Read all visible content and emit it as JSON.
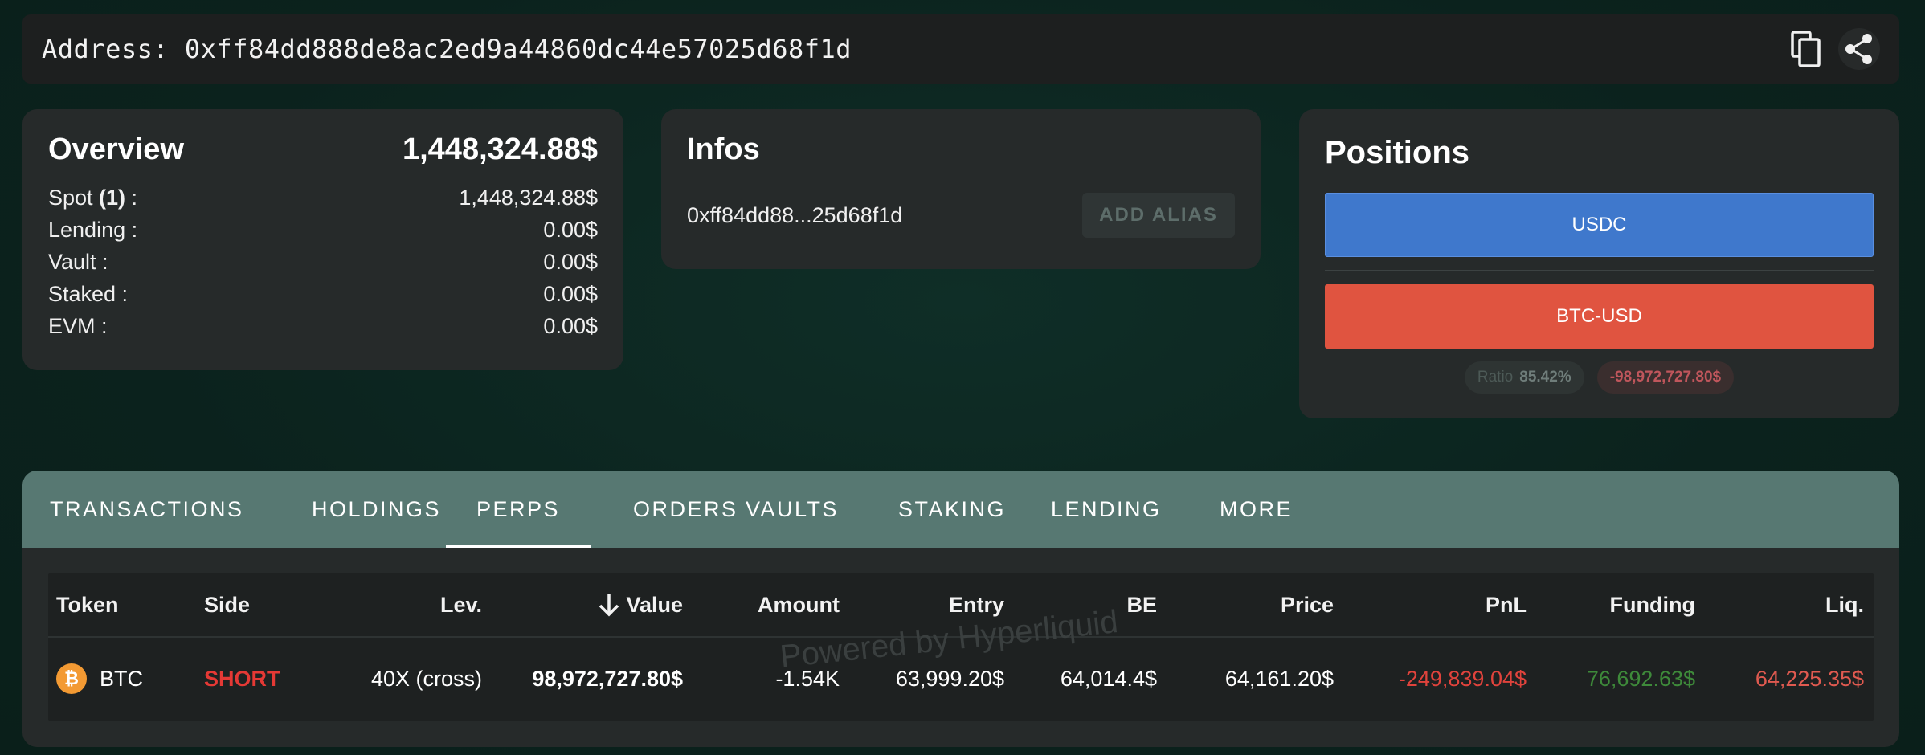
{
  "address_bar": {
    "label": "Address:",
    "address": "0xff84dd888de8ac2ed9a44860dc44e57025d68f1d"
  },
  "icons": {
    "copy": "copy-icon",
    "share": "share-icon",
    "bitcoin": "bitcoin-icon",
    "sort_arrow": "arrow-down-icon"
  },
  "overview": {
    "title": "Overview",
    "total": "1,448,324.88$",
    "rows": [
      {
        "label_prefix": "Spot ",
        "label_count": "(1)",
        "label_suffix": " :",
        "value": "1,448,324.88$"
      },
      {
        "label_prefix": "Lending :",
        "label_count": "",
        "label_suffix": "",
        "value": "0.00$"
      },
      {
        "label_prefix": "Vault :",
        "label_count": "",
        "label_suffix": "",
        "value": "0.00$"
      },
      {
        "label_prefix": "Staked :",
        "label_count": "",
        "label_suffix": "",
        "value": "0.00$"
      },
      {
        "label_prefix": "EVM :",
        "label_count": "",
        "label_suffix": "",
        "value": "0.00$"
      }
    ]
  },
  "infos": {
    "title": "Infos",
    "short_address": "0xff84dd88...25d68f1d",
    "alias_button": "ADD ALIAS"
  },
  "positions": {
    "title": "Positions",
    "bars": [
      {
        "label": "USDC",
        "color": "#3f78cc"
      },
      {
        "label": "BTC-USD",
        "color": "#e05440"
      }
    ],
    "ratio_label": "Ratio",
    "ratio_value": "85.42%",
    "net_value": "-98,972,727.80$"
  },
  "tabs": [
    {
      "label": "TRANSACTIONS",
      "active": false
    },
    {
      "label": "HOLDINGS",
      "active": false
    },
    {
      "label": "PERPS",
      "active": true
    },
    {
      "label": "ORDERS",
      "active": false
    },
    {
      "label": "VAULTS",
      "active": false
    },
    {
      "label": "STAKING",
      "active": false
    },
    {
      "label": "LENDING",
      "active": false
    },
    {
      "label": "MORE",
      "active": false
    }
  ],
  "table": {
    "headers": [
      "Token",
      "Side",
      "Lev.",
      "Value",
      "Amount",
      "Entry",
      "BE",
      "Price",
      "PnL",
      "Funding",
      "Liq."
    ],
    "rows": [
      {
        "token": "BTC",
        "side": "SHORT",
        "lev": "40X (cross)",
        "value": "98,972,727.80$",
        "amount": "-1.54K",
        "entry": "63,999.20$",
        "be": "64,014.4$",
        "price": "64,161.20$",
        "pnl": "-249,839.04$",
        "funding": "76,692.63$",
        "liq": "64,225.35$"
      }
    ],
    "watermark": "Powered by Hyperliquid"
  },
  "colors": {
    "short": "#e53935",
    "negative": "#e0433c",
    "positive": "#3e8a3a",
    "liq": "#e05a50"
  }
}
